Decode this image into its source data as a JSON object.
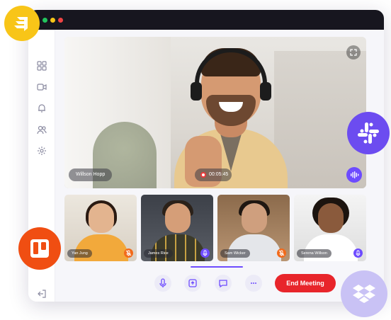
{
  "window": {
    "controls": [
      "green",
      "yellow",
      "red"
    ]
  },
  "sidebar": {
    "items": [
      {
        "icon": "grid-icon"
      },
      {
        "icon": "video-camera-icon"
      },
      {
        "icon": "bell-icon"
      },
      {
        "icon": "users-icon"
      },
      {
        "icon": "gear-icon"
      }
    ],
    "footer_icon": "logout-icon"
  },
  "main_video": {
    "participant_name": "Willson Hopp",
    "timer": "00:05:45",
    "expand_icon": "expand-icon",
    "audio_icon": "audio-wave-icon"
  },
  "participants": [
    {
      "name": "Yan Jung",
      "mic_color": "#f26a1b",
      "muted": true
    },
    {
      "name": "James Rice",
      "mic_color": "#6d4bff",
      "muted": false
    },
    {
      "name": "Sam Wicker",
      "mic_color": "#f26a1b",
      "muted": true
    },
    {
      "name": "Serena Willson",
      "mic_color": "#6d4bff",
      "muted": false
    }
  ],
  "controls": {
    "mic_icon": "microphone-icon",
    "share_icon": "share-screen-icon",
    "chat_icon": "chat-icon",
    "more_icon": "more-icon",
    "end_label": "End Meeting"
  },
  "integrations": [
    {
      "name": "Jira",
      "color": "#f8c518"
    },
    {
      "name": "Slack",
      "color": "#6c4cf0"
    },
    {
      "name": "Trello",
      "color": "#f04e12"
    },
    {
      "name": "Dropbox",
      "color": "#c9c2f5"
    }
  ],
  "colors": {
    "accent": "#6d4bff",
    "danger": "#e8252b",
    "titlebar": "#17161f"
  }
}
